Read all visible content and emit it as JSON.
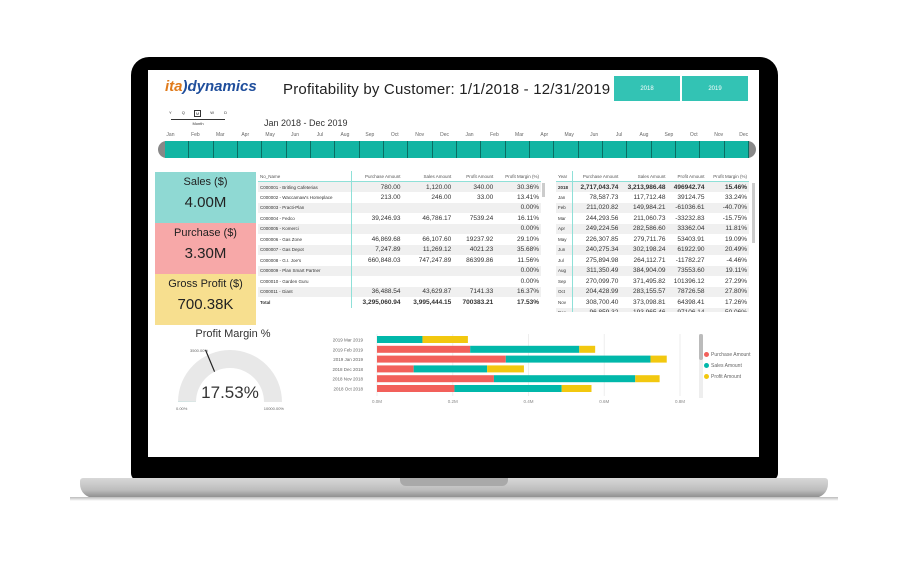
{
  "colors": {
    "teal": "#12b5a3",
    "button": "#33c3b4",
    "purchase": "#f2605b",
    "sales": "#01b8aa",
    "profit": "#f2c80f",
    "kpi_sales": "#8fd9d3",
    "kpi_purchase": "#f7a8a8",
    "kpi_profit": "#f7df8f"
  },
  "header": {
    "logo": {
      "a": "ita",
      "b": "dynamics"
    },
    "title": "Profitability by Customer: 1/1/2018 - 12/31/2019",
    "year_buttons": [
      "2018",
      "2019"
    ]
  },
  "timeline": {
    "granularity": [
      "Y",
      "Q",
      "M",
      "W",
      "D"
    ],
    "granularity_selected": "Month",
    "range": "Jan 2018 - Dec 2019",
    "months": [
      "Jan",
      "Feb",
      "Mar",
      "Apr",
      "May",
      "Jun",
      "Jul",
      "Aug",
      "Sep",
      "Oct",
      "Nov",
      "Dec",
      "Jan",
      "Feb",
      "Mar",
      "Apr",
      "May",
      "Jun",
      "Jul",
      "Aug",
      "Sep",
      "Oct",
      "Nov",
      "Dec"
    ]
  },
  "kpis": [
    {
      "label": "Sales ($)",
      "value": "4.00M"
    },
    {
      "label": "Purchase ($)",
      "value": "3.30M"
    },
    {
      "label": "Gross Profit ($)",
      "value": "700.38K"
    }
  ],
  "customer_table": {
    "headers": [
      "No_Name",
      "Purchase Amount",
      "Sales Amount",
      "Profit Amount",
      "Profit Margin (%)"
    ],
    "rows": [
      [
        "C000001 - Britling Cafeterias",
        "780.00",
        "1,120.00",
        "340.00",
        "30.36%"
      ],
      [
        "C000002 - Waccamaw's Homeplace",
        "213.00",
        "246.00",
        "33.00",
        "13.41%"
      ],
      [
        "C000003 - Practi-Plan",
        "",
        "",
        "",
        "0.00%"
      ],
      [
        "C000004 - Fedco",
        "39,246.93",
        "46,786.17",
        "7539.24",
        "16.11%"
      ],
      [
        "C000005 - Komerci",
        "",
        "",
        "",
        "0.00%"
      ],
      [
        "C000006 - Gas Zone",
        "46,869.68",
        "66,107.60",
        "19237.92",
        "29.10%"
      ],
      [
        "C000007 - Gas Depot",
        "7,247.89",
        "11,269.12",
        "4021.23",
        "35.68%"
      ],
      [
        "C000008 - G.I. Joe's",
        "660,848.03",
        "747,247.89",
        "86399.86",
        "11.56%"
      ],
      [
        "C000009 - Plan Smart Partner",
        "",
        "",
        "",
        "0.00%"
      ],
      [
        "C000010 - Garden Guru",
        "",
        "",
        "",
        "0.00%"
      ],
      [
        "C000011 - Giant",
        "36,488.54",
        "43,629.87",
        "7141.33",
        "16.37%"
      ]
    ],
    "total": [
      "Total",
      "3,295,060.94",
      "3,995,444.15",
      "700383.21",
      "17.53%"
    ]
  },
  "year_table": {
    "headers": [
      "Year",
      "Purchase Amount",
      "Sales Amount",
      "Profit Amount",
      "Profit Margin (%)"
    ],
    "rows": [
      [
        "2018",
        "2,717,043.74",
        "3,213,986.48",
        "496942.74",
        "15.46%"
      ],
      [
        "Jan",
        "78,587.73",
        "117,712.48",
        "39124.75",
        "33.24%"
      ],
      [
        "Feb",
        "211,020.82",
        "149,984.21",
        "-61036.61",
        "-40.70%"
      ],
      [
        "Mar",
        "244,293.56",
        "211,060.73",
        "-33232.83",
        "-15.75%"
      ],
      [
        "Apr",
        "249,224.56",
        "282,586.60",
        "33362.04",
        "11.81%"
      ],
      [
        "May",
        "226,307.85",
        "279,711.76",
        "53403.91",
        "19.09%"
      ],
      [
        "Jun",
        "240,275.34",
        "302,198.24",
        "61922.90",
        "20.49%"
      ],
      [
        "Jul",
        "275,894.98",
        "264,112.71",
        "-11782.27",
        "-4.46%"
      ],
      [
        "Aug",
        "311,350.49",
        "384,904.09",
        "73553.60",
        "19.11%"
      ],
      [
        "Sep",
        "270,099.70",
        "371,495.82",
        "101396.12",
        "27.29%"
      ],
      [
        "Oct",
        "204,428.99",
        "283,155.57",
        "78726.58",
        "27.80%"
      ],
      [
        "Nov",
        "308,700.40",
        "373,098.81",
        "64398.41",
        "17.26%"
      ],
      [
        "Dec",
        "96,859.32",
        "193,965.46",
        "97106.14",
        "50.06%"
      ]
    ],
    "total": [
      "Total",
      "3,295,060.94",
      "3,995,444.15",
      "700383.21",
      "17.53%"
    ]
  },
  "gauge": {
    "title": "Profit Margin %",
    "value": "17.53%",
    "value_num": 17.53,
    "min": "0.00%",
    "max": "10000.00%",
    "max_num": 10000,
    "target": "3500.00%",
    "target_num": 3500
  },
  "chart_data": {
    "type": "bar",
    "orientation": "horizontal",
    "stacked": true,
    "categories": [
      "2019 Mar 2019",
      "2019 Feb 2019",
      "2019 Jan 2019",
      "2018 Dec 2018",
      "2018 Nov 2018",
      "2018 Oct 2018"
    ],
    "series": [
      {
        "name": "Purchase Amount",
        "values": [
          0,
          246000,
          340000,
          96859.32,
          308700.4,
          204428.99
        ]
      },
      {
        "name": "Sales Amount",
        "values": [
          120000,
          288000,
          382000,
          193965.46,
          373098.81,
          283155.57
        ]
      },
      {
        "name": "Profit Amount",
        "values": [
          120000,
          42000,
          43000,
          97106.14,
          64398.41,
          78726.58
        ]
      }
    ],
    "xticks": [
      "0.0M",
      "0.2M",
      "0.4M",
      "0.6M",
      "0.8M"
    ],
    "xlim": [
      0,
      800000
    ],
    "grid": true,
    "legend": "right"
  }
}
